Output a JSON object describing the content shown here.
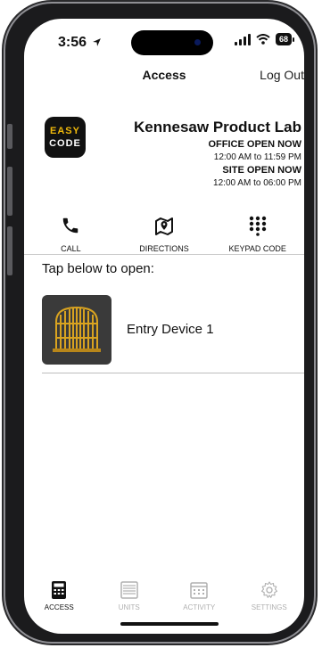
{
  "status_bar": {
    "time": "3:56",
    "battery": "68"
  },
  "header": {
    "title": "Access",
    "logout_label": "Log Out"
  },
  "site": {
    "logo_line1": "EASY",
    "logo_line2": "CODE",
    "name": "Kennesaw Product Lab",
    "office_status": "OFFICE OPEN NOW",
    "office_hours": "12:00 AM to 11:59 PM",
    "site_status": "SITE OPEN NOW",
    "site_hours": "12:00 AM to 06:00 PM"
  },
  "actions": [
    {
      "label": "CALL",
      "icon": "phone-icon"
    },
    {
      "label": "DIRECTIONS",
      "icon": "map-pin-icon"
    },
    {
      "label": "KEYPAD CODE",
      "icon": "keypad-icon"
    }
  ],
  "tap_label": "Tap below to open:",
  "devices": [
    {
      "name": "Entry Device 1",
      "icon": "gate-icon"
    }
  ],
  "tabs": [
    {
      "label": "ACCESS",
      "icon": "keypad-phone-icon",
      "active": true
    },
    {
      "label": "UNITS",
      "icon": "storage-unit-icon",
      "active": false
    },
    {
      "label": "ACTIVITY",
      "icon": "calendar-icon",
      "active": false
    },
    {
      "label": "SETTINGS",
      "icon": "gear-icon",
      "active": false
    }
  ],
  "colors": {
    "logo_accent": "#f0b90b",
    "gate_gold": "#d9a320",
    "tile_bg": "#3a3a3a"
  }
}
